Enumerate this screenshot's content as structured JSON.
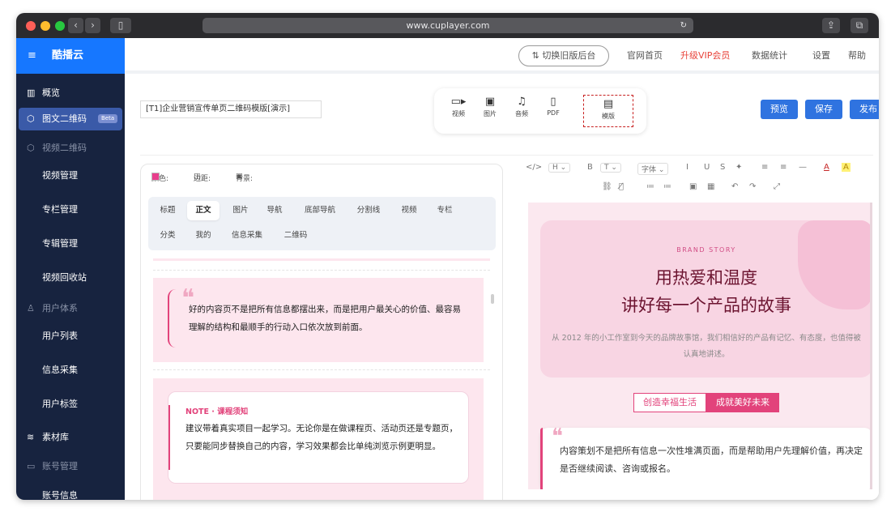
{
  "browser": {
    "url": "www.cuplayer.com"
  },
  "sidebar": {
    "brand": "酷播云",
    "items": [
      {
        "label": "概览",
        "icon": "chart-bar-icon",
        "glyph": "▥",
        "kind": "item"
      },
      {
        "label": "图文二维码",
        "icon": "cube-icon",
        "glyph": "⬡",
        "kind": "active",
        "badge": "Beta"
      },
      {
        "label": "视频二维码",
        "icon": "cube-icon",
        "glyph": "⬡",
        "kind": "group"
      },
      {
        "label": "视频管理",
        "kind": "sub"
      },
      {
        "label": "专栏管理",
        "kind": "sub"
      },
      {
        "label": "专辑管理",
        "kind": "sub"
      },
      {
        "label": "视频回收站",
        "kind": "sub"
      },
      {
        "label": "用户体系",
        "icon": "user-icon",
        "glyph": "♙",
        "kind": "group"
      },
      {
        "label": "用户列表",
        "kind": "sub"
      },
      {
        "label": "信息采集",
        "kind": "sub"
      },
      {
        "label": "用户标签",
        "kind": "sub"
      },
      {
        "label": "素材库",
        "icon": "layers-icon",
        "glyph": "≋",
        "kind": "item"
      },
      {
        "label": "账号管理",
        "icon": "id-card-icon",
        "glyph": "▭",
        "kind": "group"
      },
      {
        "label": "账号信息",
        "kind": "sub"
      }
    ]
  },
  "topnav": {
    "switch_label": "⇅ 切换旧版后台",
    "links": [
      "官网首页",
      "升级VIP会员",
      "数据统计",
      "设置",
      "帮助"
    ],
    "vip_color": "#e8433a"
  },
  "editor_header": {
    "doc_title": "[T1]企业营销宣传单页二维码模版[演示]",
    "media_tools": [
      {
        "label": "视频",
        "icon": "video-icon",
        "glyph": "▭"
      },
      {
        "label": "图片",
        "icon": "image-icon",
        "glyph": "▣"
      },
      {
        "label": "音频",
        "icon": "music-icon",
        "glyph": "♫"
      },
      {
        "label": "PDF",
        "icon": "file-icon",
        "glyph": "▯"
      },
      {
        "label": "模版",
        "icon": "template-icon",
        "glyph": "▤"
      }
    ],
    "buttons": {
      "preview": "预览",
      "save": "保存",
      "publish": "发布"
    }
  },
  "style_panel": {
    "color_label": "颜色:",
    "margin_label": "边距:",
    "bg_label": "背景:",
    "accent": "#e83e8c",
    "tabs_row1": [
      "标题",
      "正文",
      "图片",
      "导航",
      "底部导航",
      "分割线",
      "视频",
      "专栏"
    ],
    "tabs_row2": [
      "分类",
      "我的",
      "信息采集",
      "二维码"
    ],
    "active_tab": "正文"
  },
  "blocks": {
    "quote_text": "好的内容页不是把所有信息都摆出来，而是把用户最关心的价值、最容易理解的结构和最顺手的行动入口依次放到前面。",
    "note_title": "NOTE · 课程须知",
    "note_text": "建议带着真实项目一起学习。无论你是在做课程页、活动页还是专题页，只要能同步替换自己的内容，学习效果都会比单纯浏览示例更明显。"
  },
  "rich_toolbar": {
    "row1": [
      "</>",
      "H ⌄",
      "B",
      "T ⌄",
      "字体 ⌄",
      "I",
      "U",
      "S",
      "✦",
      "≡",
      "≡",
      "—",
      "A",
      "A"
    ],
    "row2": [
      "⛓",
      "⛓̸",
      "≔",
      "≔",
      "▣",
      "▦",
      "↶",
      "↷",
      "⤢"
    ]
  },
  "preview": {
    "brand_story": "BRAND STORY",
    "headline_1": "用热爱和温度",
    "headline_2": "讲好每一个产品的故事",
    "subtitle": "从 2012 年的小工作室到今天的品牌故事馆，我们相信好的产品有记忆、有态度，也值得被认真地讲述。",
    "tag_1": "创造幸福生活",
    "tag_2": "成就美好未来",
    "card_text": "内容策划不是把所有信息一次性堆满页面，而是帮助用户先理解价值，再决定是否继续阅读、咨询或报名。",
    "accent": "#e2437b"
  }
}
